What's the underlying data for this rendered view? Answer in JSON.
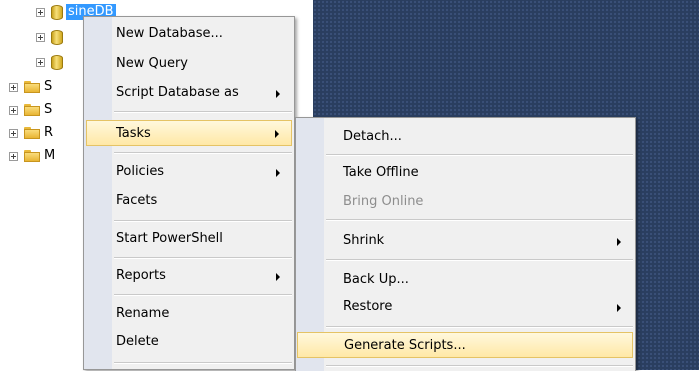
{
  "tree": {
    "selected_label": "sineDB",
    "folder_letters": [
      "S",
      "S",
      "R",
      "M"
    ]
  },
  "context_menu": {
    "items": [
      {
        "label": "New Database..."
      },
      {
        "label": "New Query"
      },
      {
        "label": "Script Database as"
      },
      {
        "label": "Tasks"
      },
      {
        "label": "Policies"
      },
      {
        "label": "Facets"
      },
      {
        "label": "Start PowerShell"
      },
      {
        "label": "Reports"
      },
      {
        "label": "Rename"
      },
      {
        "label": "Delete"
      }
    ]
  },
  "tasks_submenu": {
    "items": [
      {
        "label": "Detach..."
      },
      {
        "label": "Take Offline"
      },
      {
        "label": "Bring Online",
        "disabled": true
      },
      {
        "label": "Shrink"
      },
      {
        "label": "Back Up..."
      },
      {
        "label": "Restore"
      },
      {
        "label": "Generate Scripts..."
      }
    ]
  },
  "colors": {
    "selection": "#3399ff",
    "menu_highlight": "#ffe8a6",
    "background_panel": "#2a3e5f"
  }
}
